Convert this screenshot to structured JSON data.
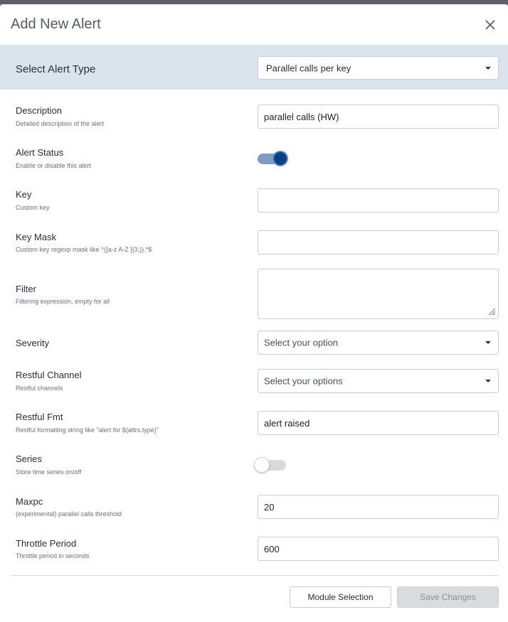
{
  "modal": {
    "title": "Add New Alert",
    "close_icon": "close-icon"
  },
  "alert_type": {
    "label": "Select Alert Type",
    "value": "Parallel calls per key"
  },
  "fields": {
    "description": {
      "label": "Description",
      "sub": "Detailed description of the alert",
      "value": "parallel calls (HW)"
    },
    "alert_status": {
      "label": "Alert Status",
      "sub": "Enable or disable this alert",
      "enabled": true
    },
    "key": {
      "label": "Key",
      "sub": "Custom key",
      "value": ""
    },
    "key_mask": {
      "label": "Key Mask",
      "sub": "Custom key regexp mask like ^([a-z A-Z ]{3,}).*$",
      "value": ""
    },
    "filter": {
      "label": "Filter",
      "sub": "Filtering expression, empty for all",
      "value": ""
    },
    "severity": {
      "label": "Severity",
      "value": "Select your option"
    },
    "restful_channel": {
      "label": "Restful Channel",
      "sub": "Restful channels",
      "value": "Select your options"
    },
    "restful_fmt": {
      "label": "Restful Fmt",
      "sub": "Restful formatting string like \"alert for ${attrs.type}\"",
      "value": "alert raised"
    },
    "series": {
      "label": "Series",
      "sub": "Store time series on/off",
      "enabled": false
    },
    "maxpc": {
      "label": "Maxpc",
      "sub": "(experimental) parallel calls threshold",
      "value": "20"
    },
    "throttle_period": {
      "label": "Throttle Period",
      "sub": "Throttle period in seconds",
      "value": "600"
    }
  },
  "footer": {
    "module_selection_label": "Module Selection",
    "save_label": "Save Changes"
  },
  "colors": {
    "accent": "#0c3f84",
    "type_bar_bg": "#dbe3ec"
  }
}
